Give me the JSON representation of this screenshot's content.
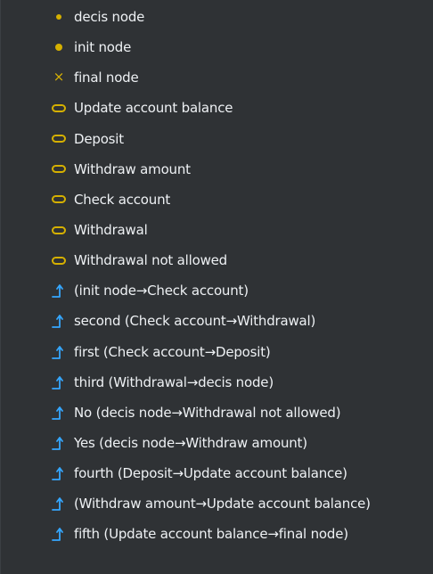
{
  "colors": {
    "background": "#2f3235",
    "node_icon": "#d5b000",
    "edge_icon": "#35a7ff",
    "text": "#eef1f4"
  },
  "items": [
    {
      "label": "decis node",
      "icon": "decision-node-icon"
    },
    {
      "label": "init node",
      "icon": "initial-node-icon"
    },
    {
      "label": "final node",
      "icon": "final-node-icon"
    },
    {
      "label": "Update account balance",
      "icon": "activity-node-icon"
    },
    {
      "label": "Deposit",
      "icon": "activity-node-icon"
    },
    {
      "label": "Withdraw amount",
      "icon": "activity-node-icon"
    },
    {
      "label": "Check account",
      "icon": "activity-node-icon"
    },
    {
      "label": "Withdrawal",
      "icon": "activity-node-icon"
    },
    {
      "label": "Withdrawal not allowed",
      "icon": "activity-node-icon"
    },
    {
      "label": "(init node→Check account)",
      "icon": "edge-icon"
    },
    {
      "label": "second (Check account→Withdrawal)",
      "icon": "edge-icon"
    },
    {
      "label": "first (Check account→Deposit)",
      "icon": "edge-icon"
    },
    {
      "label": "third (Withdrawal→decis node)",
      "icon": "edge-icon"
    },
    {
      "label": "No (decis node→Withdrawal not allowed)",
      "icon": "edge-icon"
    },
    {
      "label": "Yes (decis node→Withdraw amount)",
      "icon": "edge-icon"
    },
    {
      "label": "fourth (Deposit→Update account balance)",
      "icon": "edge-icon"
    },
    {
      "label": "(Withdraw amount→Update account balance)",
      "icon": "edge-icon"
    },
    {
      "label": "fifth (Update account balance→final node)",
      "icon": "edge-icon"
    }
  ]
}
